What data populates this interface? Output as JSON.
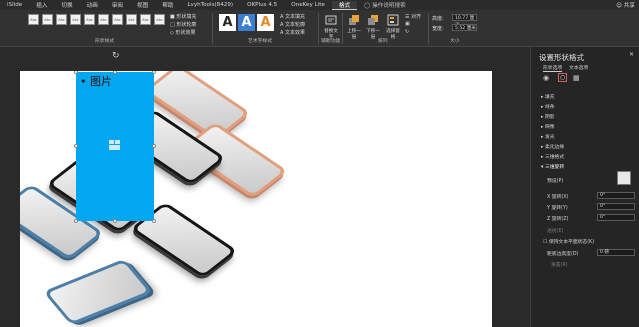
{
  "tabs": [
    {
      "label": "iSlide"
    },
    {
      "label": "插入"
    },
    {
      "label": "切换"
    },
    {
      "label": "动画"
    },
    {
      "label": "审阅"
    },
    {
      "label": "视图"
    },
    {
      "label": "帮助"
    },
    {
      "label": "LvyhTools(8429)"
    },
    {
      "label": "OKPlus 4.5"
    },
    {
      "label": "OneKey Lite"
    },
    {
      "label": "格式"
    },
    {
      "label": "操作说明搜索"
    }
  ],
  "share_label": "共享",
  "ribbon": {
    "shape_styles_label": "形状样式",
    "shape_style_sample": "Abc",
    "shape_fill": "形状填充",
    "shape_outline": "形状轮廓",
    "shape_effects": "形状效果",
    "wordart_label": "艺术字样式",
    "wordart_letter": "A",
    "text_fill": "文本填充",
    "text_outline": "文本轮廓",
    "text_effects": "文本效果",
    "accessibility_label": "辅助功能",
    "alt_text": "替换文字",
    "arrange_label": "排列",
    "bring_forward": "上移一层",
    "send_backward": "下移一层",
    "selection_pane": "选择窗格",
    "align": "对齐",
    "size_label": "大小",
    "height_label": "高度:",
    "height_value": "10.77 厘米",
    "width_label": "宽度:",
    "width_value": "5.52 厘米"
  },
  "slide": {
    "bullet_text": "• 图片"
  },
  "pane": {
    "title": "设置形状格式",
    "tab_shape": "形状选项",
    "tab_text": "文本选项",
    "sections": [
      "填充",
      "线条",
      "阴影",
      "映像",
      "发光",
      "柔化边缘",
      "三维格式",
      "三维旋转"
    ],
    "preset_label": "预设(P)",
    "x_rotation_label": "X 旋转(X)",
    "x_rotation_value": "0°",
    "y_rotation_label": "Y 旋转(Y)",
    "y_rotation_value": "0°",
    "z_rotation_label": "Z 旋转(Z)",
    "z_rotation_value": "0°",
    "perspective_label": "透视(E)",
    "keep_text_flat": "保持文本平面状态(K)",
    "distance_label": "距底边高度(D)",
    "distance_value": "0 磅",
    "reset_label": "重置(R)"
  },
  "colors": {
    "accent_shape": "#02a7ef",
    "pane_bg": "#252525",
    "ribbon_bg": "#323232"
  }
}
